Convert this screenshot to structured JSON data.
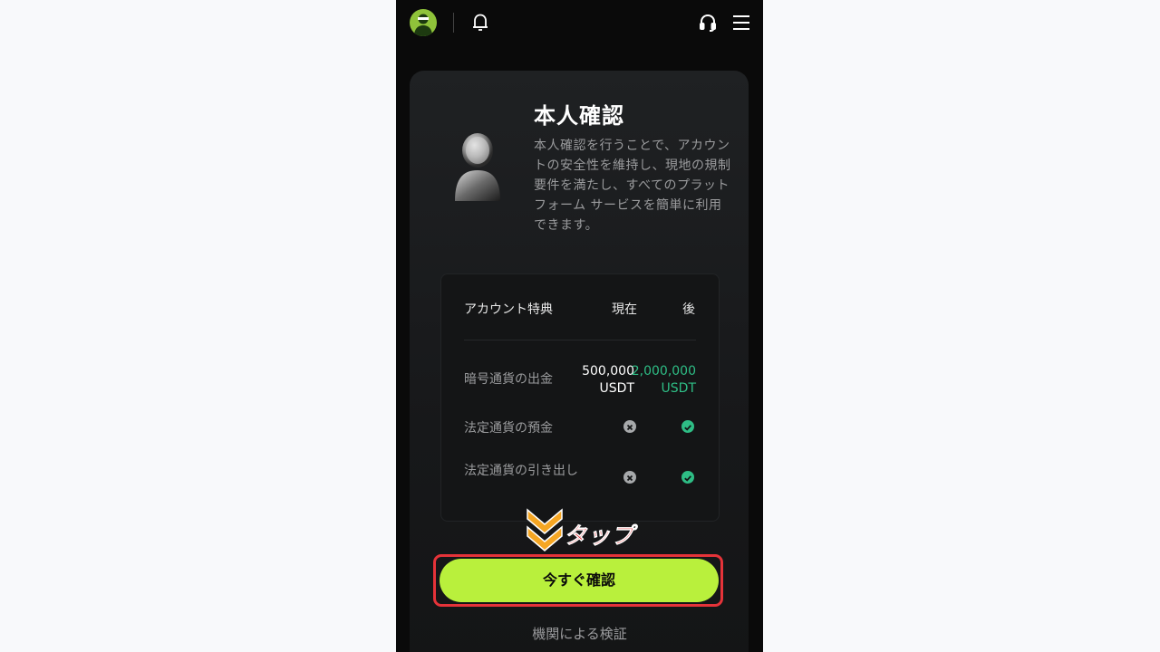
{
  "header": {
    "avatar_icon": "user-avatar-icon",
    "bell_icon": "bell-icon",
    "support_icon": "headset-icon",
    "menu_icon": "hamburger-menu-icon"
  },
  "card": {
    "title": "本人確認",
    "description": "本人確認を行うことで、アカウントの安全性を維持し、現地の規制要件を満たし、すべてのプラットフォーム サービスを簡単に利用できます。",
    "illustration": "person-silhouette-icon"
  },
  "benefits": {
    "header": {
      "label": "アカウント特典",
      "now": "現在",
      "after": "後"
    },
    "rows": [
      {
        "label": "暗号通貨の出金",
        "now": "500,000 USDT",
        "after": "2,000,000 USDT"
      },
      {
        "label": "法定通貨の預金",
        "now_icon": "x-circle-icon",
        "after_icon": "check-circle-icon"
      },
      {
        "label": "法定通貨の引き出し",
        "now_icon": "x-circle-icon",
        "after_icon": "check-circle-icon"
      }
    ]
  },
  "annotation": {
    "tap_text": "タップ",
    "arrow_icon": "double-chevron-down-icon"
  },
  "cta": {
    "label": "今すぐ確認"
  },
  "institutional": {
    "label": "機関による検証"
  },
  "colors": {
    "accent": "#b9f03c",
    "positive": "#2ebd85",
    "annotation_red": "#e53339",
    "annotation_orange": "#f5a623"
  }
}
